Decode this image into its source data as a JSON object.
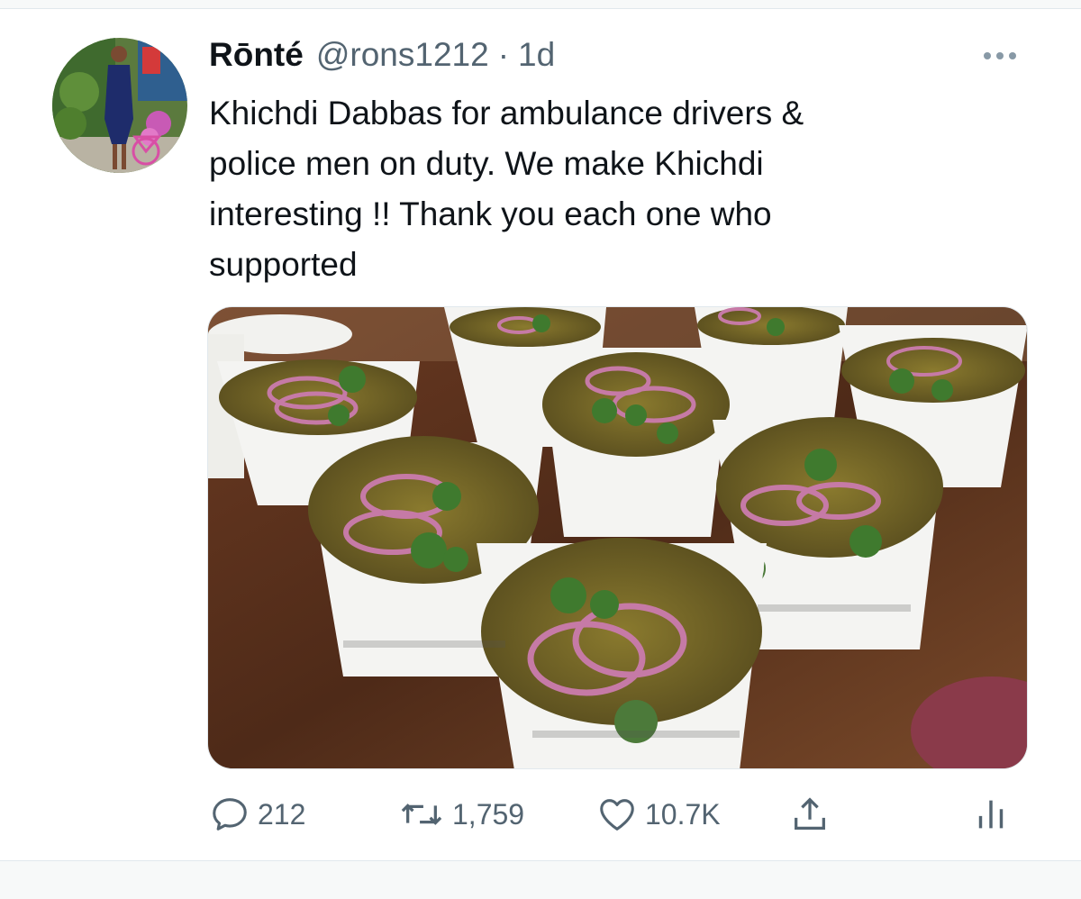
{
  "tweet": {
    "display_name": "Rōnté",
    "handle": "@rons1212",
    "separator": "·",
    "time": "1d",
    "text_lines": [
      "Khichdi Dabbas for ambulance drivers &",
      "police men on duty. We make Khichdi",
      "interesting !! Thank you each one who",
      "supported"
    ]
  },
  "actions": {
    "reply_count": "212",
    "retweet_count": "1,759",
    "like_count": "10.7K"
  },
  "icons": {
    "more": "more-horizontal-icon",
    "reply": "reply-icon",
    "retweet": "retweet-icon",
    "like": "heart-icon",
    "share": "share-icon",
    "analytics": "analytics-icon"
  },
  "colors": {
    "text": "#0f1419",
    "secondary": "#536471",
    "border": "#e1e8ed"
  }
}
